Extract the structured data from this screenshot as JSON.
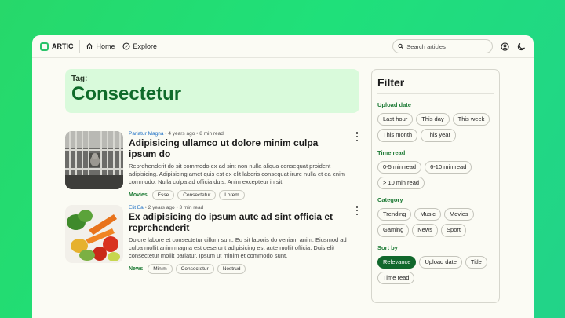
{
  "app": {
    "name": "ARTIC"
  },
  "nav": [
    {
      "label": "Home",
      "icon": "home-icon"
    },
    {
      "label": "Explore",
      "icon": "compass-icon"
    }
  ],
  "search": {
    "placeholder": "Search articles"
  },
  "header_icons": [
    "account-icon",
    "dark-mode-icon"
  ],
  "tag": {
    "label": "Tag:",
    "title": "Consectetur"
  },
  "articles": [
    {
      "author": "Pariatur Magna",
      "meta": " • 4 years ago • 8 min read",
      "title": "Adipisicing ullamco ut dolore minim culpa ipsum do",
      "description": "Reprehenderit do sit commodo ex ad sint non nulla aliqua consequat proident adipisicing. Adipisicing amet quis est ex elit laboris consequat irure nulla et ea enim commodo. Nulla culpa ad officia duis. Anim excepteur in sit",
      "category": "Movies",
      "tags": [
        "Esse",
        "Consectetur",
        "Lorem"
      ]
    },
    {
      "author": "Elit Ea",
      "meta": " • 2 years ago • 3 min read",
      "title": "Ex adipisicing do ipsum aute ad sint officia et reprehenderit",
      "description": "Dolore labore et consectetur cillum sunt. Eu sit laboris do veniam anim. Eiusmod ad culpa mollit anim magna est deserunt adipisicing est aute mollit officia. Duis elit consectetur mollit pariatur. Ipsum ut minim et commodo sunt.",
      "category": "News",
      "tags": [
        "Minim",
        "Consectetur",
        "Nostrud"
      ]
    }
  ],
  "filter": {
    "title": "Filter",
    "sections": [
      {
        "title": "Upload date",
        "options": [
          "Last hour",
          "This day",
          "This week",
          "This month",
          "This year"
        ]
      },
      {
        "title": "Time read",
        "options": [
          "0-5 min read",
          "6-10 min read",
          "> 10 min read"
        ]
      },
      {
        "title": "Category",
        "options": [
          "Trending",
          "Music",
          "Movies",
          "Gaming",
          "News",
          "Sport"
        ]
      },
      {
        "title": "Sort by",
        "options": [
          "Relevance",
          "Upload date",
          "Title",
          "Time read"
        ],
        "selected": "Relevance"
      }
    ]
  },
  "colors": {
    "accent": "#11682c",
    "tag_bg": "#d9fadb",
    "author_link": "#1c6fc4"
  }
}
